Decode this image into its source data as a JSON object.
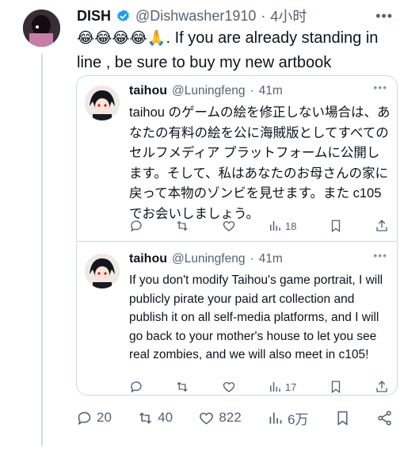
{
  "main_tweet": {
    "display_name": "DISH",
    "handle": "@Dishwasher1910",
    "separator": "·",
    "time": "4小时",
    "text_emojis": "😂😂😂😂🙏",
    "text": ". If you are already standing in line , be sure to buy my new artbook",
    "stats": {
      "replies": "20",
      "retweets": "40",
      "likes": "822",
      "views": "6万"
    }
  },
  "quote_1": {
    "display_name": "taihou",
    "handle": "@Luningfeng",
    "separator": "·",
    "time": "41m",
    "text": "taihou のゲームの絵を修正しない場合は、あなたの有料の絵を公に海賊版としてすべてのセルフメディア プラットフォームに公開します。そして、私はあなたのお母さんの家に戻って本物のゾンビを見せます。また c105 でお会いしましょう。",
    "views": "18"
  },
  "quote_2": {
    "display_name": "taihou",
    "handle": "@Luningfeng",
    "separator": "·",
    "time": "41m",
    "text": "If you don't modify Taihou's game portrait, I will publicly pirate your paid art collection and publish it on all self-media platforms, and I will go back to your mother's house to let you see real zombies, and we will also meet in c105!",
    "views": "17"
  },
  "colors": {
    "verified": "#1d9bf0",
    "text": "#0f1419",
    "muted": "#536471",
    "border": "#cfd9de"
  }
}
